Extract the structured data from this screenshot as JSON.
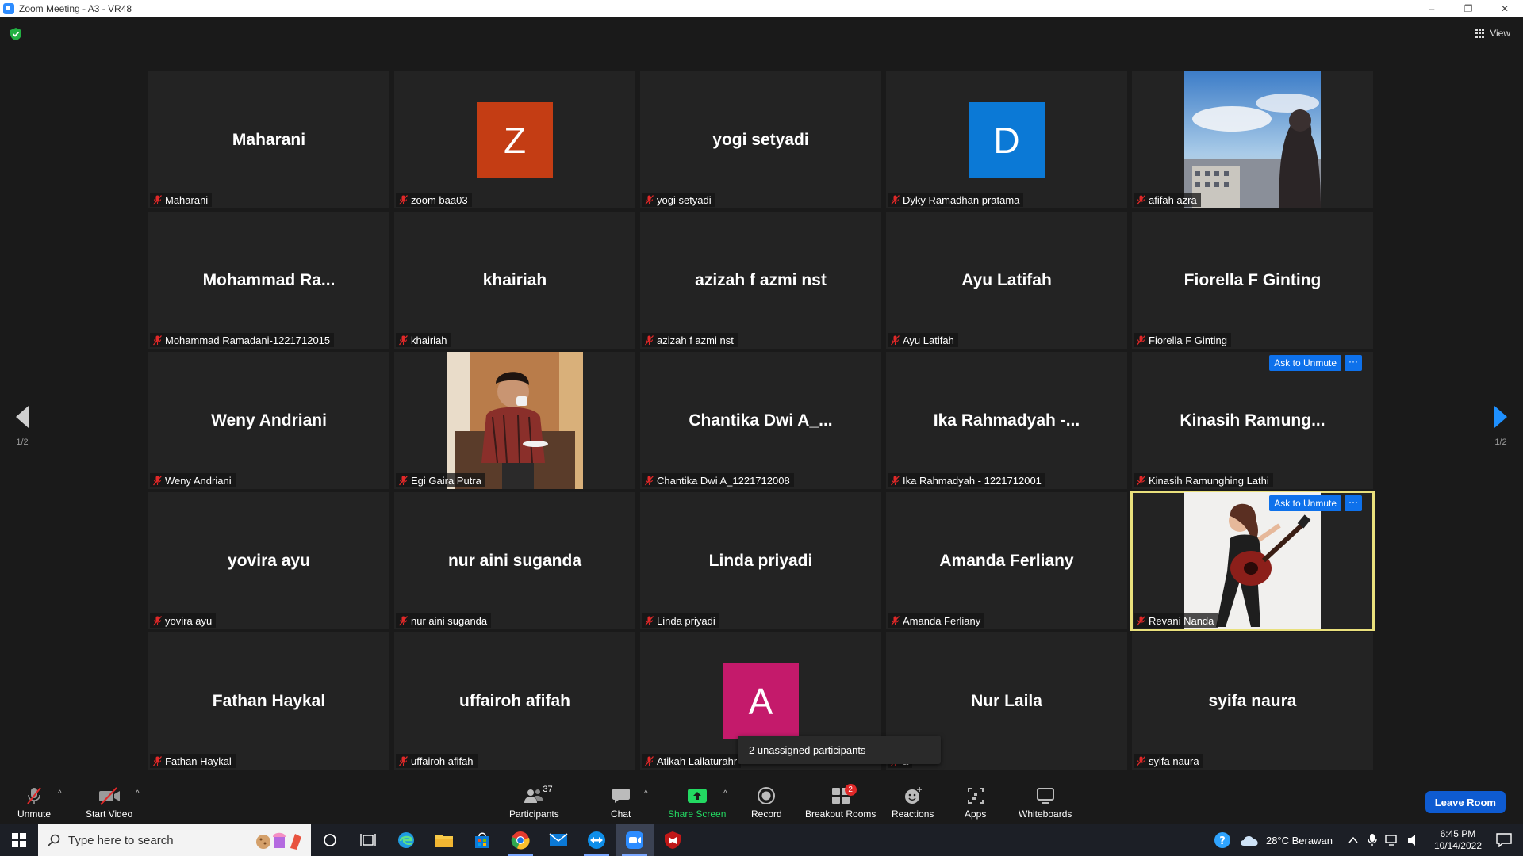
{
  "window": {
    "title": "Zoom Meeting - A3 - VR48",
    "controls": [
      "–",
      "❐",
      "✕"
    ]
  },
  "topbar": {
    "view_label": "View"
  },
  "pagination": {
    "left": "1/2",
    "right": "1/2"
  },
  "participants": [
    {
      "big": "Maharani",
      "label": "Maharani"
    },
    {
      "initial": "Z",
      "color": "#c43d14",
      "label": "zoom baa03"
    },
    {
      "big": "yogi setyadi",
      "label": "yogi setyadi"
    },
    {
      "initial": "D",
      "color": "#0b79d6",
      "label": "Dyky Ramadhan pratama"
    },
    {
      "photo": "city",
      "label": "afifah azra"
    },
    {
      "big": "Mohammad  Ra...",
      "label": "Mohammad Ramadani-1221712015"
    },
    {
      "big": "khairiah",
      "label": "khairiah"
    },
    {
      "big": "azizah f azmi nst",
      "label": "azizah f azmi nst"
    },
    {
      "big": "Ayu Latifah",
      "label": "Ayu Latifah"
    },
    {
      "big": "Fiorella F Ginting",
      "label": "Fiorella F Ginting"
    },
    {
      "big": "Weny Andriani",
      "label": "Weny Andriani"
    },
    {
      "photo": "man",
      "label": "Egi Gaira Putra"
    },
    {
      "big": "Chantika  Dwi  A_...",
      "label": "Chantika Dwi A_1221712008"
    },
    {
      "big": "Ika  Rahmadyah  -...",
      "label": "Ika Rahmadyah - 1221712001"
    },
    {
      "big": "Kinasih  Ramung...",
      "label": "Kinasih Ramunghing Lathi",
      "ask": true
    },
    {
      "big": "yovira ayu",
      "label": "yovira ayu"
    },
    {
      "big": "nur aini suganda",
      "label": "nur aini suganda"
    },
    {
      "big": "Linda priyadi",
      "label": "Linda priyadi"
    },
    {
      "big": "Amanda Ferliany",
      "label": "Amanda Ferliany"
    },
    {
      "photo": "guitar",
      "label": "Revani Nanda",
      "ask": true,
      "active": true
    },
    {
      "big": "Fathan Haykal",
      "label": "Fathan Haykal"
    },
    {
      "big": "uffairoh afifah",
      "label": "uffairoh afifah"
    },
    {
      "initial": "A",
      "color": "#c41a6b",
      "label": "Atikah Lailaturahr"
    },
    {
      "big": "Nur Laila",
      "label": "a"
    },
    {
      "big": "syifa naura",
      "label": "syifa naura"
    }
  ],
  "tile_actions": {
    "ask_label": "Ask to Unmute",
    "more_label": "···"
  },
  "tooltip": "2 unassigned participants",
  "toolbar": {
    "unmute": "Unmute",
    "start_video": "Start Video",
    "participants": "Participants",
    "participants_count": "37",
    "chat": "Chat",
    "share_screen": "Share Screen",
    "record": "Record",
    "breakout_rooms": "Breakout Rooms",
    "breakout_badge": "2",
    "reactions": "Reactions",
    "apps": "Apps",
    "whiteboards": "Whiteboards",
    "leave": "Leave Room",
    "accent_green": "#23d962",
    "accent_blue": "#0e71eb"
  },
  "taskbar": {
    "search_placeholder": "Type here to search",
    "weather": "28°C  Berawan",
    "time": "6:45 PM",
    "date": "10/14/2022",
    "apps": [
      "task-view-icon",
      "edge-icon",
      "file-explorer-icon",
      "store-icon",
      "chrome-icon",
      "mail-icon",
      "teamviewer-icon",
      "zoom-icon",
      "mcafee-icon"
    ]
  }
}
